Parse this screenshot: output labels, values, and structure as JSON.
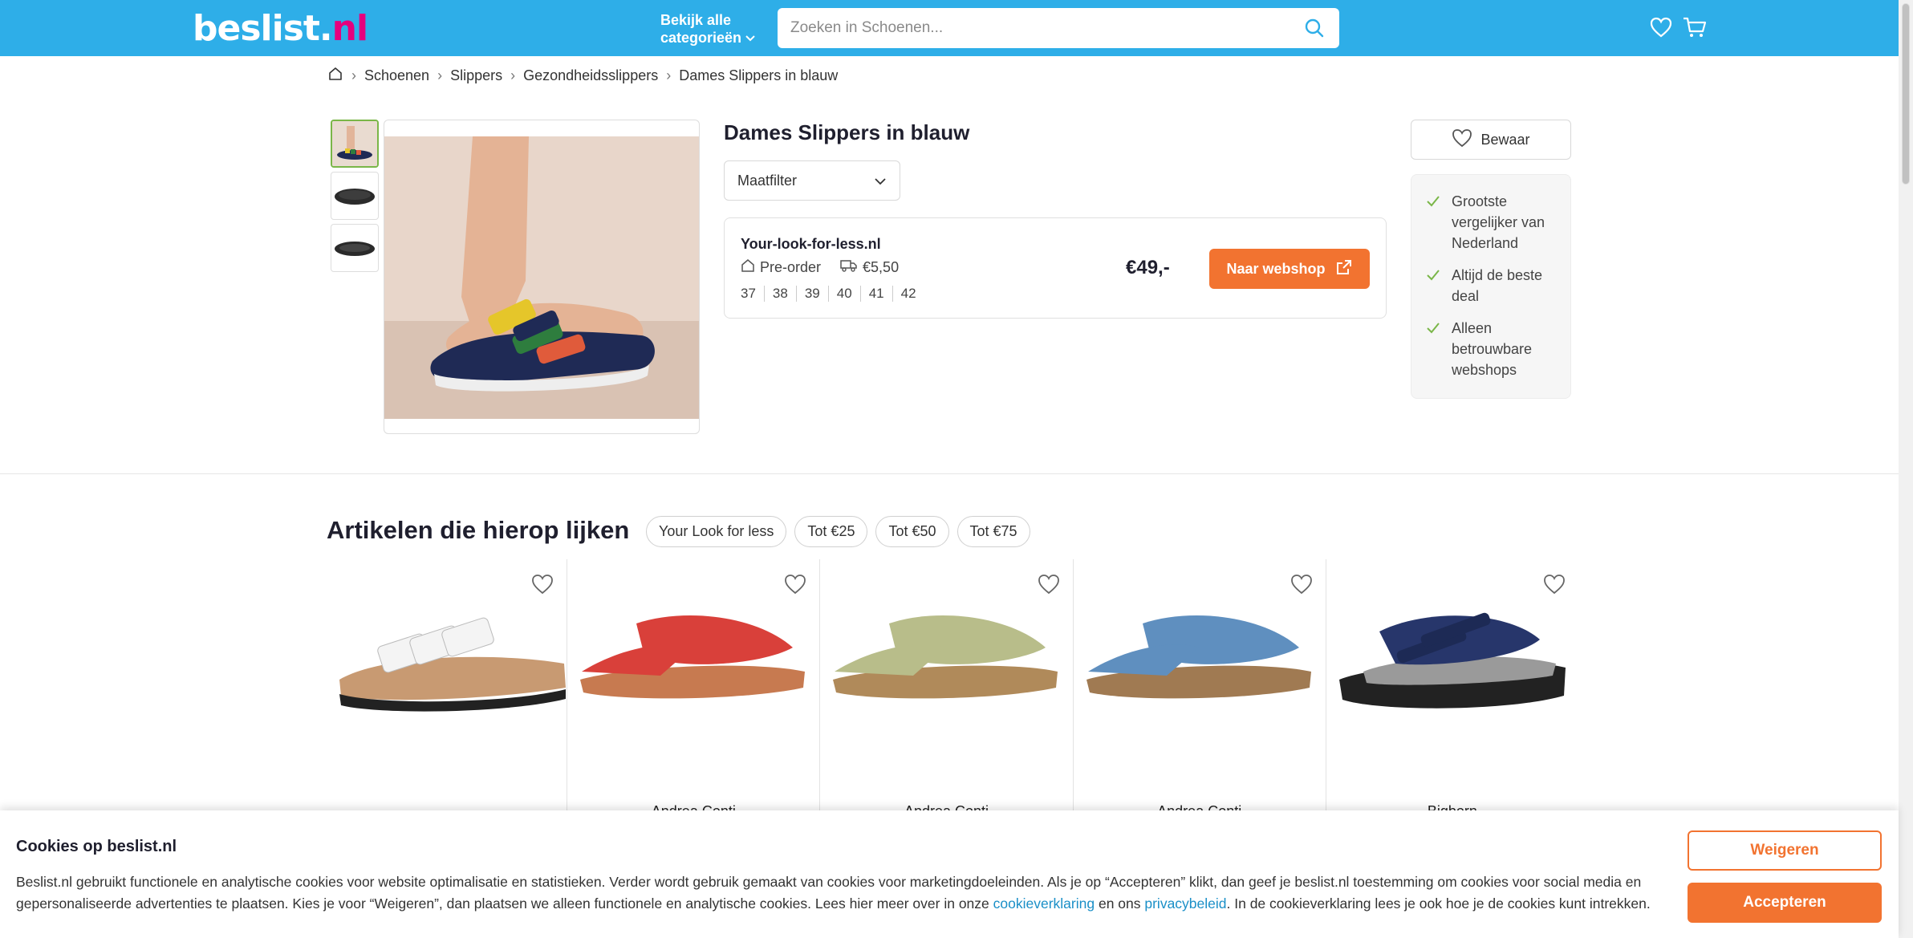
{
  "header": {
    "logo_main": "beslist",
    "logo_dot": ".",
    "logo_tld": "nl",
    "categories_line1": "Bekijk alle",
    "categories_line2": "categorieën",
    "search_placeholder": "Zoeken in Schoenen..."
  },
  "breadcrumb": [
    "Schoenen",
    "Slippers",
    "Gezondheidsslippers",
    "Dames Slippers in blauw"
  ],
  "product": {
    "title": "Dames Slippers in blauw",
    "size_filter_label": "Maatfilter",
    "offer": {
      "shop": "Your-look-for-less.nl",
      "availability": "Pre-order",
      "shipping": "€5,50",
      "sizes": [
        "37",
        "38",
        "39",
        "40",
        "41",
        "42"
      ],
      "price": "€49,-",
      "cta": "Naar webshop"
    }
  },
  "side": {
    "save_label": "Bewaar",
    "usps": [
      "Grootste vergelijker van Nederland",
      "Altijd de beste deal",
      "Alleen betrouwbare webshops"
    ]
  },
  "similar": {
    "title": "Artikelen die hierop lijken",
    "chips": [
      "Your Look for less",
      "Tot €25",
      "Tot €50",
      "Tot €75"
    ],
    "items": [
      {
        "brand": "",
        "color": "#f4f4f4"
      },
      {
        "brand": "Andrea Conti",
        "color": "#d9403a"
      },
      {
        "brand": "Andrea Conti",
        "color": "#b8bd8a"
      },
      {
        "brand": "Andrea Conti",
        "color": "#5f8fbf"
      },
      {
        "brand": "Bigborn",
        "color": "#27366b"
      }
    ]
  },
  "cookie": {
    "title": "Cookies op beslist.nl",
    "text_1": "Beslist.nl gebruikt functionele en analytische cookies voor website optimalisatie en statistieken. Verder wordt gebruik gemaakt van cookies voor marketingdoeleinden. Als je op “Accepteren” klikt, dan geef je beslist.nl toestemming om cookies voor social media en gepersonaliseerde advertenties te plaatsen. Kies je voor “Weigeren”, dan plaatsen we alleen functionele en analytische cookies. Lees hier meer over in onze ",
    "link_cookie": "cookieverklaring",
    "text_2": " en ons ",
    "link_privacy": "privacybeleid",
    "text_3": ". In de cookieverklaring lees je ook hoe je de cookies kunt intrekken.",
    "refuse": "Weigeren",
    "accept": "Accepteren"
  },
  "colors": {
    "header_bg": "#2eaee8",
    "accent_orange": "#f27330",
    "logo_nl": "#e6007e",
    "check_green": "#7ab648"
  }
}
